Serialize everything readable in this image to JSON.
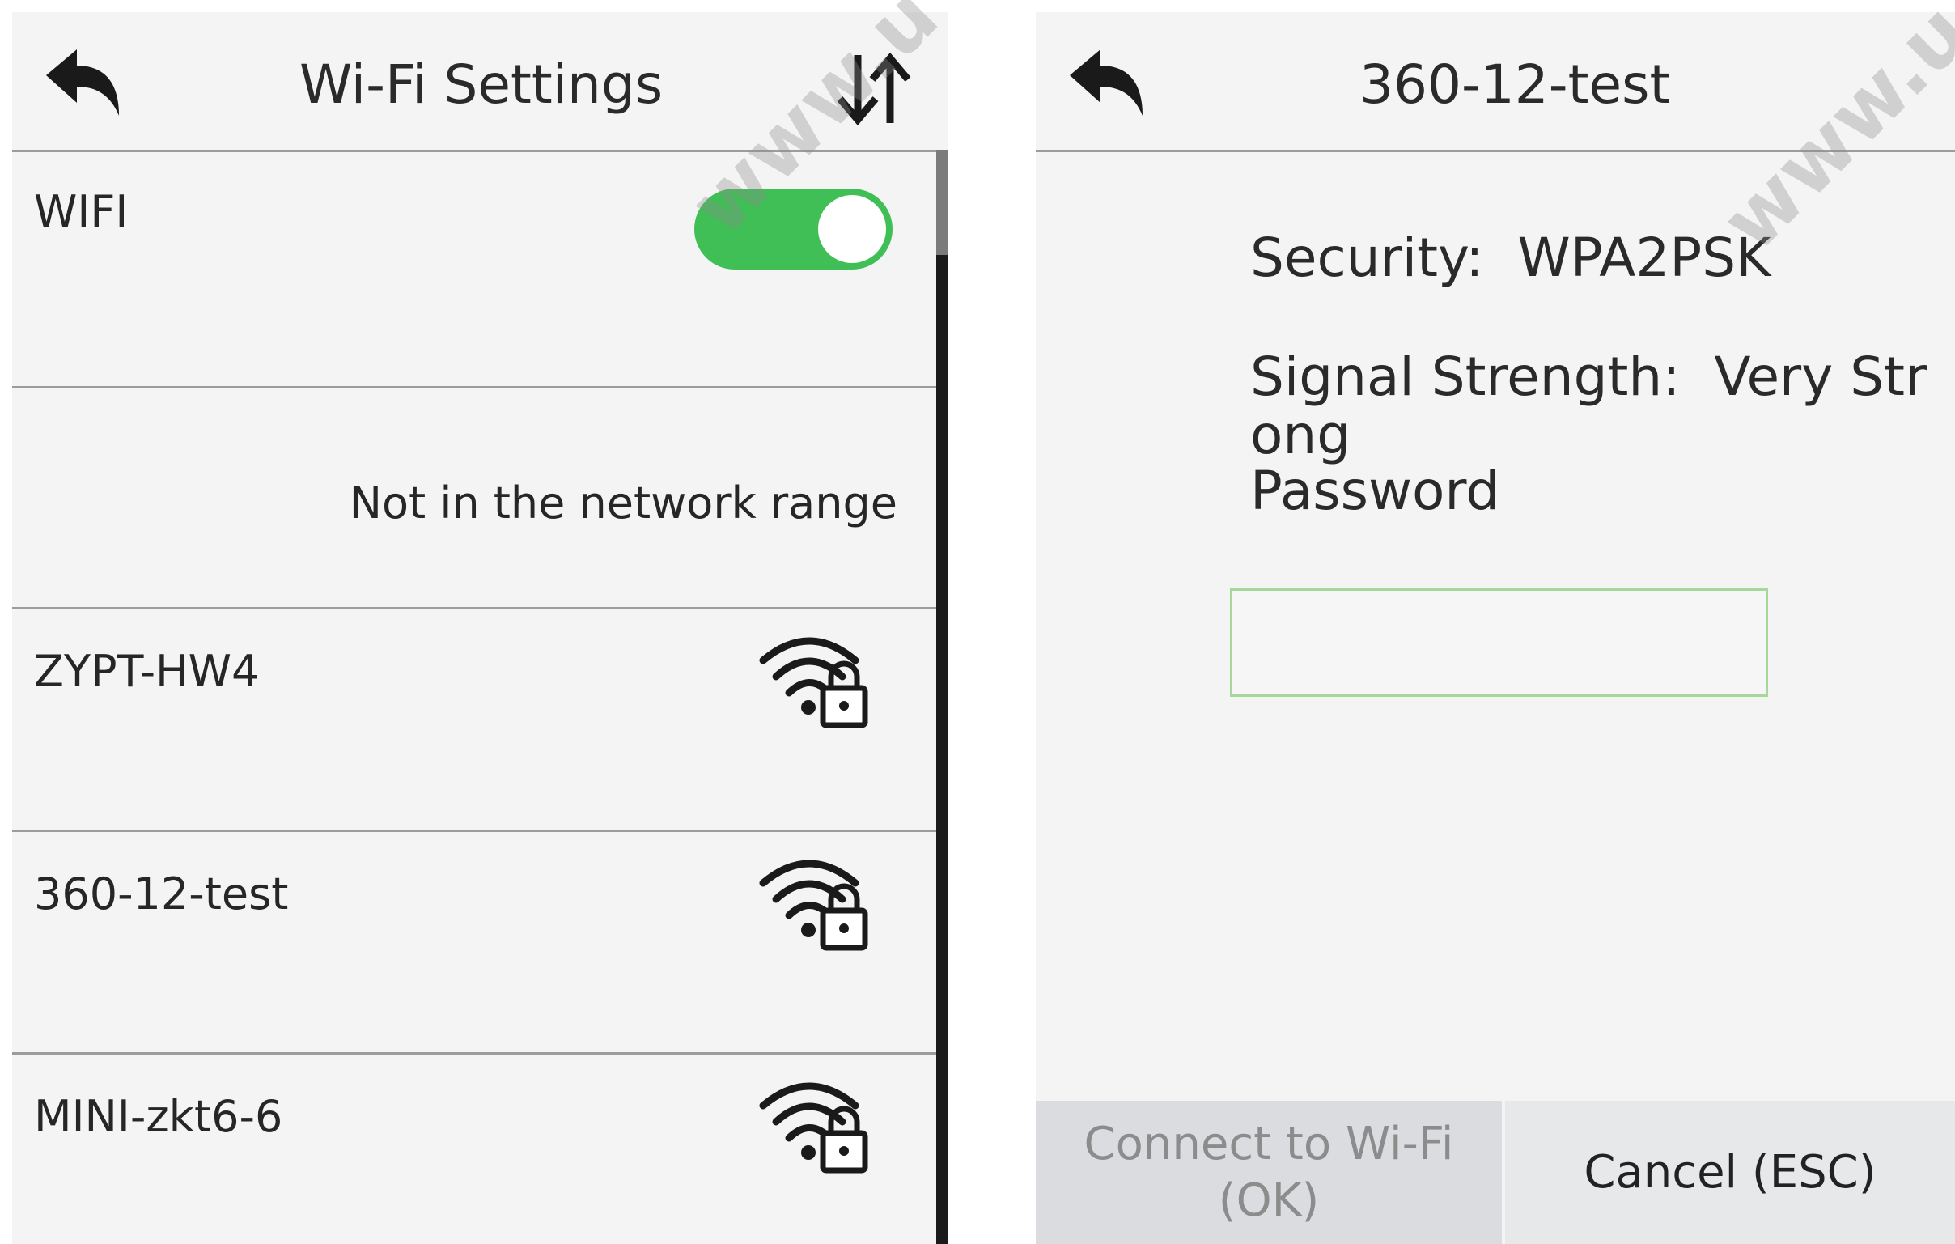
{
  "left_screen": {
    "title": "Wi-Fi Settings",
    "back_icon": "back-arrow-icon",
    "sort_icon": "sort-arrows-icon",
    "wifi_toggle": {
      "label": "WIFI",
      "state": "on",
      "color": "#3fbf55"
    },
    "status_message": "Not in the network range",
    "networks": [
      {
        "ssid": "ZYPT-HW4",
        "icon": "wifi-lock-icon"
      },
      {
        "ssid": "360-12-test",
        "icon": "wifi-lock-icon"
      },
      {
        "ssid": "MINI-zkt6-6",
        "icon": "wifi-lock-icon"
      }
    ]
  },
  "right_screen": {
    "title": "360-12-test",
    "back_icon": "back-arrow-icon",
    "security_label": "Security:",
    "security_value": "WPA2PSK",
    "signal_label": "Signal Strength:",
    "signal_value": "Very Strong",
    "password_label": "Password",
    "password_value": "",
    "connect_line1": "Connect to Wi-Fi",
    "connect_line2": "(OK)",
    "cancel_label": "Cancel (ESC)"
  },
  "watermark_text": "www.u",
  "colors": {
    "accent": "#3fbf55",
    "input_border": "#a6d89c",
    "background": "#f4f4f4"
  }
}
